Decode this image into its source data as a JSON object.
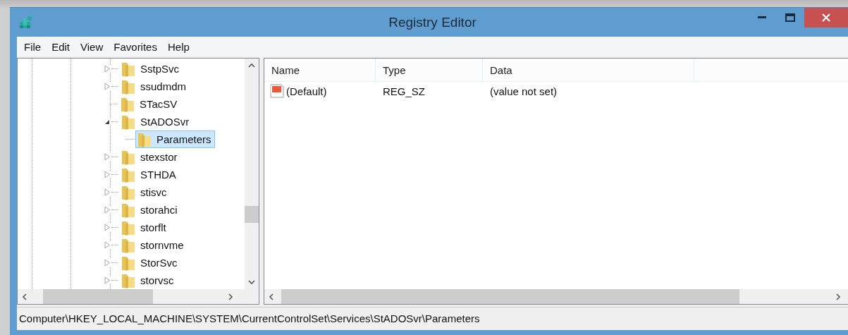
{
  "window": {
    "title": "Registry Editor"
  },
  "menu": [
    {
      "label": "File"
    },
    {
      "label": "Edit"
    },
    {
      "label": "View"
    },
    {
      "label": "Favorites"
    },
    {
      "label": "Help"
    }
  ],
  "tree": [
    {
      "label": "SstpSvc",
      "kind": "collapsed",
      "selected": false
    },
    {
      "label": "ssudmdm",
      "kind": "collapsed",
      "selected": false
    },
    {
      "label": "STacSV",
      "kind": "leaf",
      "selected": false
    },
    {
      "label": "StADOSvr",
      "kind": "expanded",
      "selected": false,
      "children": [
        {
          "label": "Parameters",
          "kind": "leaf",
          "selected": true
        }
      ]
    },
    {
      "label": "stexstor",
      "kind": "collapsed",
      "selected": false
    },
    {
      "label": "STHDA",
      "kind": "collapsed",
      "selected": false
    },
    {
      "label": "stisvc",
      "kind": "collapsed",
      "selected": false
    },
    {
      "label": "storahci",
      "kind": "collapsed",
      "selected": false
    },
    {
      "label": "storflt",
      "kind": "collapsed",
      "selected": false
    },
    {
      "label": "stornvme",
      "kind": "collapsed",
      "selected": false
    },
    {
      "label": "StorSvc",
      "kind": "collapsed",
      "selected": false
    },
    {
      "label": "storvsc",
      "kind": "collapsed",
      "selected": false
    }
  ],
  "values": {
    "columns": [
      "Name",
      "Type",
      "Data"
    ],
    "rows": [
      {
        "name": "(Default)",
        "type": "REG_SZ",
        "data": "(value not set)",
        "kind": "string"
      }
    ]
  },
  "status_bar": "Computer\\HKEY_LOCAL_MACHINE\\SYSTEM\\CurrentControlSet\\Services\\StADOSvr\\Parameters"
}
